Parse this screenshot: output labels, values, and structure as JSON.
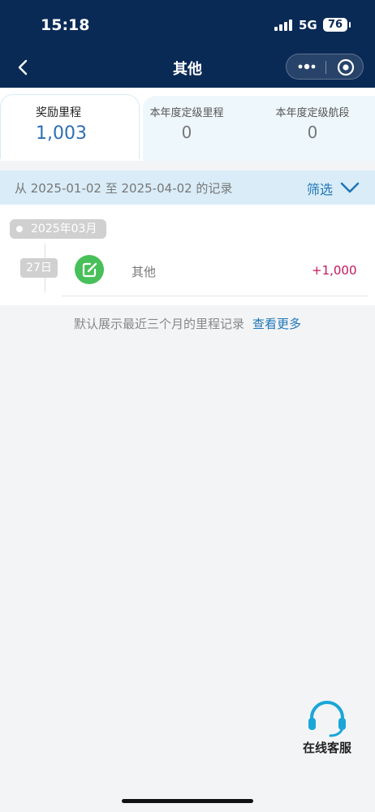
{
  "status_bar": {
    "time": "15:18",
    "network": "5G",
    "battery": "76"
  },
  "nav": {
    "title": "其他"
  },
  "stats": [
    {
      "label": "奖励里程",
      "value": "1,003"
    },
    {
      "label": "本年度定级里程",
      "value": "0"
    },
    {
      "label": "本年度定级航段",
      "value": "0"
    }
  ],
  "filter_bar": {
    "range": "从 2025-01-02 至 2025-04-02 的记录",
    "filter_label": "筛选"
  },
  "records": {
    "month": "2025年03月",
    "items": [
      {
        "day": "27日",
        "title": "其他",
        "amount": "+1,000",
        "icon": "edit-icon"
      }
    ]
  },
  "footer": {
    "note": "默认展示最近三个月的里程记录",
    "link": "查看更多"
  },
  "customer_service": {
    "label": "在线客服",
    "icon": "headset-icon"
  },
  "colors": {
    "header": "#0a2a56",
    "accent": "#1f76b8",
    "amount": "#c2185b",
    "record_icon": "#48c05a"
  }
}
